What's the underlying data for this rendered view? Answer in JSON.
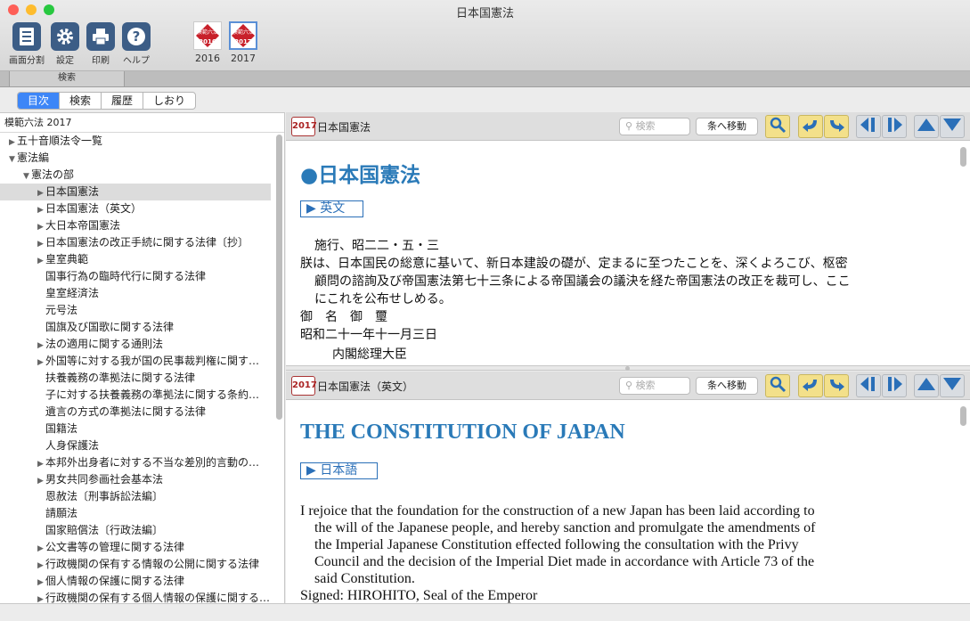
{
  "window": {
    "title": "日本国憲法",
    "traffic_colors": [
      "#fe5f57",
      "#febc2e",
      "#28c840"
    ]
  },
  "toolbar": {
    "buttons": [
      {
        "label": "画面分割",
        "icon": "split-view-icon"
      },
      {
        "label": "設定",
        "icon": "gear-icon"
      },
      {
        "label": "印刷",
        "icon": "printer-icon"
      },
      {
        "label": "ヘルプ",
        "icon": "help-icon"
      }
    ],
    "years": [
      {
        "label": "2016",
        "cover_year": "2016",
        "cover_text": "模範六法"
      },
      {
        "label": "2017",
        "cover_year": "2017",
        "cover_text": "模範六法",
        "selected": true
      }
    ]
  },
  "search_strip": {
    "tab_label": "検索"
  },
  "segments": [
    "目次",
    "検索",
    "履歴",
    "しおり"
  ],
  "sidebar": {
    "header": "模範六法 2017",
    "items": [
      {
        "label": "五十音順法令一覧",
        "level": 0,
        "arrow": "right"
      },
      {
        "label": "憲法編",
        "level": 0,
        "arrow": "down"
      },
      {
        "label": "憲法の部",
        "level": 1,
        "arrow": "down"
      },
      {
        "label": "日本国憲法",
        "level": 2,
        "arrow": "right",
        "selected": true
      },
      {
        "label": "日本国憲法（英文）",
        "level": 2,
        "arrow": "right"
      },
      {
        "label": "大日本帝国憲法",
        "level": 2,
        "arrow": "right"
      },
      {
        "label": "日本国憲法の改正手続に関する法律〔抄〕",
        "level": 2,
        "arrow": "right"
      },
      {
        "label": "皇室典範",
        "level": 2,
        "arrow": "right"
      },
      {
        "label": "国事行為の臨時代行に関する法律",
        "level": 2,
        "arrow": ""
      },
      {
        "label": "皇室経済法",
        "level": 2,
        "arrow": ""
      },
      {
        "label": "元号法",
        "level": 2,
        "arrow": ""
      },
      {
        "label": "国旗及び国歌に関する法律",
        "level": 2,
        "arrow": ""
      },
      {
        "label": "法の適用に関する通則法",
        "level": 2,
        "arrow": "right"
      },
      {
        "label": "外国等に対する我が国の民事裁判権に関す…",
        "level": 2,
        "arrow": "right"
      },
      {
        "label": "扶養義務の準拠法に関する法律",
        "level": 2,
        "arrow": ""
      },
      {
        "label": "子に対する扶養義務の準拠法に関する条約…",
        "level": 2,
        "arrow": ""
      },
      {
        "label": "遺言の方式の準拠法に関する法律",
        "level": 2,
        "arrow": ""
      },
      {
        "label": "国籍法",
        "level": 2,
        "arrow": ""
      },
      {
        "label": "人身保護法",
        "level": 2,
        "arrow": ""
      },
      {
        "label": "本邦外出身者に対する不当な差別的言動の…",
        "level": 2,
        "arrow": "right"
      },
      {
        "label": "男女共同参画社会基本法",
        "level": 2,
        "arrow": "right"
      },
      {
        "label": "恩赦法〔刑事訴訟法編〕",
        "level": 2,
        "arrow": ""
      },
      {
        "label": "請願法",
        "level": 2,
        "arrow": ""
      },
      {
        "label": "国家賠償法〔行政法編〕",
        "level": 2,
        "arrow": ""
      },
      {
        "label": "公文書等の管理に関する法律",
        "level": 2,
        "arrow": "right"
      },
      {
        "label": "行政機関の保有する情報の公開に関する法律",
        "level": 2,
        "arrow": "right"
      },
      {
        "label": "個人情報の保護に関する法律",
        "level": 2,
        "arrow": "right"
      },
      {
        "label": "行政機関の保有する個人情報の保護に関する…",
        "level": 2,
        "arrow": "right"
      }
    ]
  },
  "pane_common": {
    "search_placeholder": "検索",
    "goto_label": "条へ移動",
    "icons": [
      "zoom-icon",
      "back-icon",
      "forward-icon",
      "prev-icon",
      "next-icon",
      "up-icon",
      "down-icon"
    ]
  },
  "pane_top": {
    "badge": "2017",
    "title": "日本国憲法",
    "heading": "●日本国憲法",
    "link": "▶ 英文",
    "lines": [
      "施行、昭二二・五・三",
      "朕は、日本国民の総意に基いて、新日本建設の礎が、定まるに至つたことを、深くよろこび、枢密",
      "顧問の諮詢及び帝国憲法第七十三条による帝国議会の議決を経た帝国憲法の改正を裁可し、ここ",
      "にこれを公布せしめる。",
      "御　名　御　璽",
      "昭和二十一年十一月三日",
      "内閣総理大臣"
    ]
  },
  "pane_bottom": {
    "badge": "2017",
    "title": "日本国憲法（英文）",
    "heading": "THE CONSTITUTION OF JAPAN",
    "link": "▶ 日本語",
    "lines": [
      "I rejoice that the foundation for the construction of a new Japan has been laid according to",
      "the will of the Japanese people, and hereby sanction and promulgate the amendments of",
      "the Imperial Japanese Constitution effected following the consultation with the Privy",
      "Council and the decision of the Imperial Diet made in accordance with Article 73 of the",
      "said Constitution.",
      "Signed: HIROHITO, Seal of the Emperor"
    ]
  }
}
